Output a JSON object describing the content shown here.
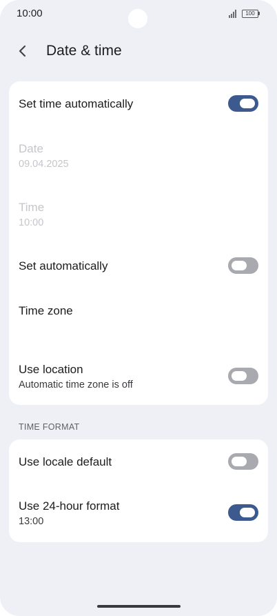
{
  "status_bar": {
    "time": "10:00",
    "battery": "100"
  },
  "header": {
    "title": "Date & time"
  },
  "auto_section": {
    "set_time_auto": {
      "label": "Set time automatically",
      "on": true
    },
    "date": {
      "label": "Date",
      "value": "09.04.2025"
    },
    "time": {
      "label": "Time",
      "value": "10:00"
    },
    "set_zone_auto": {
      "label": "Set automatically",
      "on": false
    },
    "time_zone": {
      "label": "Time zone"
    },
    "use_location": {
      "label": "Use location",
      "summary": "Automatic time zone is off",
      "on": false
    }
  },
  "time_format": {
    "header": "TIME FORMAT",
    "locale_default": {
      "label": "Use locale default",
      "on": false
    },
    "use_24h": {
      "label": "Use 24-hour format",
      "summary": "13:00",
      "on": true
    }
  },
  "colors": {
    "accent": "#3d5a8f",
    "background": "#eef0f6",
    "toggle_off": "#a9aab0"
  }
}
